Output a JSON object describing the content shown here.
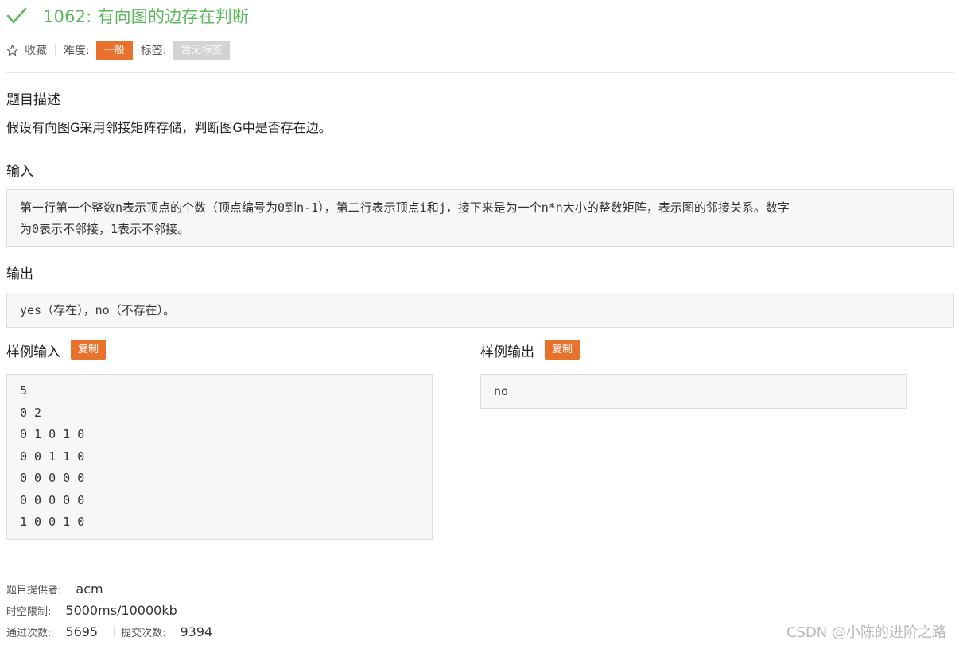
{
  "problem": {
    "title": "1062: 有向图的边存在判断",
    "favorite_label": "收藏",
    "difficulty_label": "难度:",
    "difficulty_value": "一般",
    "tags_label": "标签:",
    "tags_value": "暂无标签"
  },
  "sections": {
    "description_title": "题目描述",
    "description_text": "假设有向图G采用邻接矩阵存储，判断图G中是否存在边。",
    "input_title": "输入",
    "input_line1": "第一行第一个整数n表示顶点的个数（顶点编号为0到n-1），第二行表示顶点i和j，接下来是为一个n*n大小的整数矩阵，表示图的邻接关系。数字",
    "input_line2": "为0表示不邻接，1表示不邻接。",
    "output_title": "输出",
    "output_text": "yes（存在），no（不存在）。"
  },
  "samples": {
    "input_title": "样例输入",
    "output_title": "样例输出",
    "copy_label": "复制",
    "input_lines": [
      "5",
      "0 2",
      "0 1 0 1 0",
      "0 0 1 1 0",
      "0 0 0 0 0",
      "0 0 0 0 0",
      "1 0 0 1 0"
    ],
    "output_text": "no"
  },
  "info": {
    "provider_label": "题目提供者:",
    "provider_value": "acm",
    "limit_label": "时空限制:",
    "limit_value": "5000ms/10000kb",
    "accepted_label": "通过次数:",
    "accepted_value": "5695",
    "submit_label": "提交次数:",
    "submit_value": "9394"
  },
  "watermark": "CSDN @小陈的进阶之路",
  "colors": {
    "title_green": "#5cb85c",
    "badge_orange": "#e8712b",
    "badge_gray": "#d3d3d3"
  }
}
